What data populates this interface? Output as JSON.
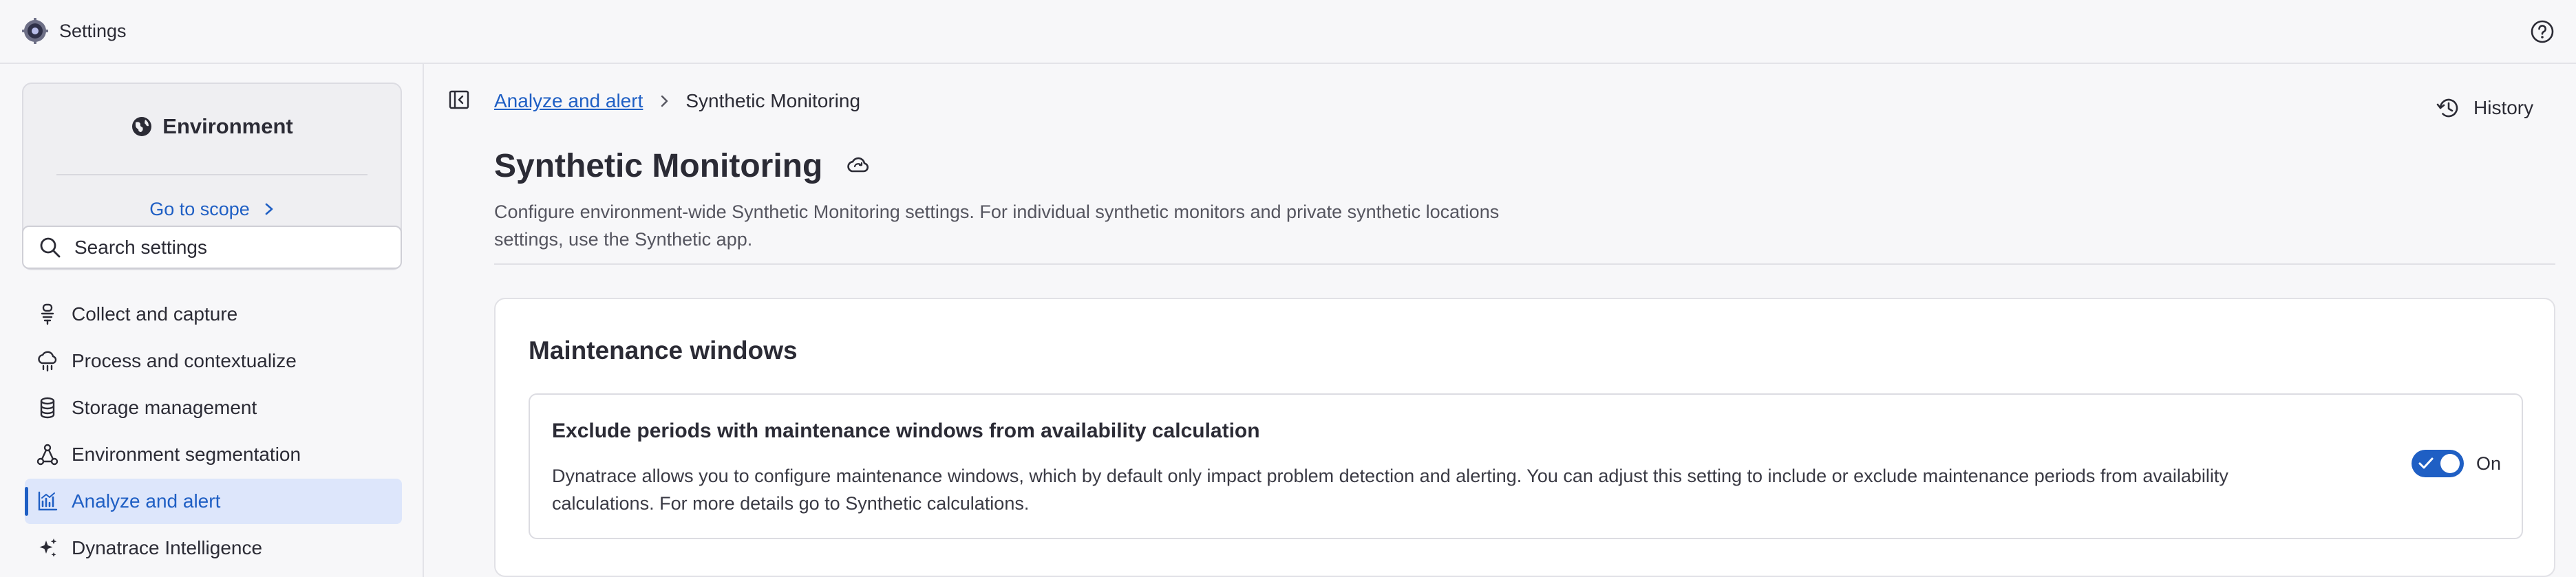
{
  "app": {
    "title": "Settings",
    "logo_icon": "settings-gear-logo-icon",
    "help_icon": "help-circle-icon"
  },
  "sidebar": {
    "environment": {
      "title": "Environment",
      "icon": "globe-icon",
      "scope_link": "Go to scope"
    },
    "search": {
      "placeholder": "Search settings",
      "value": ""
    },
    "items": [
      {
        "label": "Collect and capture",
        "icon": "capture-icon",
        "active": false
      },
      {
        "label": "Process and contextualize",
        "icon": "cloud-process-icon",
        "active": false
      },
      {
        "label": "Storage management",
        "icon": "database-icon",
        "active": false
      },
      {
        "label": "Environment segmentation",
        "icon": "segmentation-icon",
        "active": false
      },
      {
        "label": "Analyze and alert",
        "icon": "chart-alert-icon",
        "active": true
      },
      {
        "label": "Dynatrace Intelligence",
        "icon": "sparkle-icon",
        "active": false
      }
    ]
  },
  "breadcrumb": {
    "parent": "Analyze and alert",
    "current": "Synthetic Monitoring"
  },
  "history_label": "History",
  "page": {
    "title": "Synthetic Monitoring",
    "description": "Configure environment-wide Synthetic Monitoring settings. For individual synthetic monitors and private synthetic locations settings, use the Synthetic app."
  },
  "section": {
    "title": "Maintenance windows",
    "setting": {
      "title": "Exclude periods with maintenance windows from availability calculation",
      "description": "Dynatrace allows you to configure maintenance windows, which by default only impact problem detection and alerting. You can adjust this setting to include or exclude maintenance periods from availability calculations. For more details go to Synthetic calculations.",
      "toggle_state": "On",
      "enabled": true
    }
  },
  "colors": {
    "accent": "#1f5fc4",
    "active_nav_bg": "#dde6fb",
    "background": "#f7f7f9"
  }
}
